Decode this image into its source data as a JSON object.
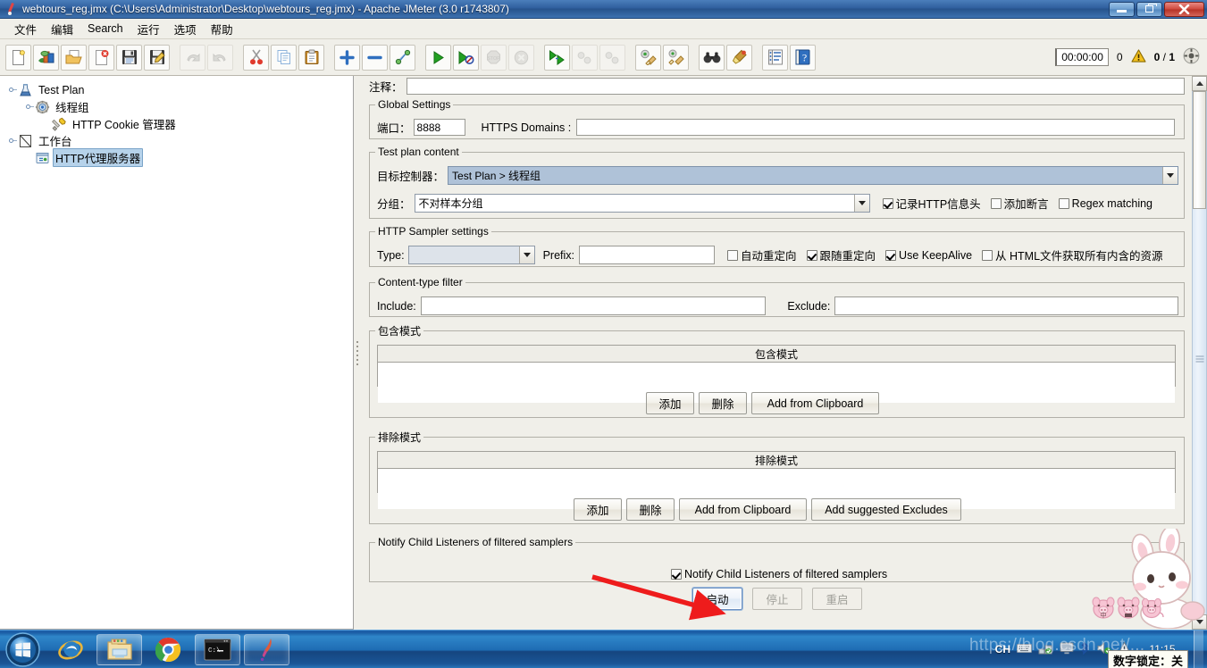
{
  "window": {
    "title": "webtours_reg.jmx (C:\\Users\\Administrator\\Desktop\\webtours_reg.jmx) - Apache JMeter (3.0 r1743807)",
    "app_icon": "jmeter-feather-icon",
    "minimize_label": "–",
    "maximize_label": "❐",
    "close_label": "✕"
  },
  "menubar": {
    "items": [
      {
        "label": "文件",
        "name": "menu-file"
      },
      {
        "label": "编辑",
        "name": "menu-edit"
      },
      {
        "label": "Search",
        "name": "menu-search"
      },
      {
        "label": "运行",
        "name": "menu-run"
      },
      {
        "label": "选项",
        "name": "menu-options"
      },
      {
        "label": "帮助",
        "name": "menu-help"
      }
    ]
  },
  "toolbar": {
    "buttons": [
      {
        "icon": "new-file-icon",
        "enabled": true
      },
      {
        "icon": "templates-icon",
        "enabled": true
      },
      {
        "icon": "open-folder-icon",
        "enabled": true
      },
      {
        "icon": "close-file-icon",
        "enabled": true
      },
      {
        "icon": "save-icon",
        "enabled": true
      },
      {
        "icon": "save-as-icon",
        "enabled": true
      },
      {
        "icon": "undo-icon",
        "enabled": false
      },
      {
        "icon": "redo-icon",
        "enabled": false
      },
      {
        "icon": "cut-icon",
        "enabled": true
      },
      {
        "icon": "copy-icon",
        "enabled": true
      },
      {
        "icon": "paste-icon",
        "enabled": true
      },
      {
        "icon": "expand-all-icon",
        "enabled": true
      },
      {
        "icon": "collapse-all-icon",
        "enabled": true
      },
      {
        "icon": "toggle-icon",
        "enabled": true
      },
      {
        "icon": "start-icon",
        "enabled": true
      },
      {
        "icon": "start-no-timers-icon",
        "enabled": true
      },
      {
        "icon": "stop-icon",
        "enabled": false
      },
      {
        "icon": "shutdown-icon",
        "enabled": false
      },
      {
        "icon": "start-remote-icon",
        "enabled": true
      },
      {
        "icon": "stop-remote-icon",
        "enabled": false
      },
      {
        "icon": "shutdown-remote-icon",
        "enabled": false
      },
      {
        "icon": "clear-icon",
        "enabled": true
      },
      {
        "icon": "clear-all-icon",
        "enabled": true
      },
      {
        "icon": "search-binoculars-icon",
        "enabled": true
      },
      {
        "icon": "reset-search-icon",
        "enabled": true
      },
      {
        "icon": "function-helper-icon",
        "enabled": true
      },
      {
        "icon": "help-icon",
        "enabled": true
      }
    ],
    "status": {
      "timer": "00:00:00",
      "warning_count": "0",
      "warning_icon": "warning-triangle-icon",
      "threads_active": "0",
      "threads_separator": "/",
      "threads_total": "1",
      "remote_icon": "remote-engines-icon"
    }
  },
  "tree": {
    "nodes": [
      {
        "label": "Test Plan",
        "icon": "test-plan-icon",
        "depth": 0,
        "selected": false,
        "expandable": true
      },
      {
        "label": "线程组",
        "icon": "thread-group-icon",
        "depth": 1,
        "selected": false,
        "expandable": true
      },
      {
        "label": "HTTP Cookie 管理器",
        "icon": "cookie-manager-icon",
        "depth": 2,
        "selected": false,
        "expandable": false
      },
      {
        "label": "工作台",
        "icon": "workbench-icon",
        "depth": 0,
        "selected": false,
        "expandable": true
      },
      {
        "label": "HTTP代理服务器",
        "icon": "http-proxy-server-icon",
        "depth": 1,
        "selected": true,
        "expandable": false
      }
    ]
  },
  "panel": {
    "comment_label": "注释：",
    "comment_value": "",
    "global_settings": {
      "legend": "Global Settings",
      "port_label": "端口：",
      "port_value": "8888",
      "https_domains_label": "HTTPS Domains :",
      "https_domains_value": ""
    },
    "test_plan_content": {
      "legend": "Test plan content",
      "target_controller_label": "目标控制器：",
      "target_controller_value": "Test Plan > 线程组",
      "grouping_label": "分组：",
      "grouping_value": "不对样本分组",
      "checkboxes": [
        {
          "label": "记录HTTP信息头",
          "checked": true,
          "name": "capture-http-headers-checkbox"
        },
        {
          "label": "添加断言",
          "checked": false,
          "name": "add-assertions-checkbox"
        },
        {
          "label": "Regex matching",
          "checked": false,
          "name": "regex-matching-checkbox"
        }
      ]
    },
    "http_sampler_settings": {
      "legend": "HTTP Sampler settings",
      "type_label": "Type:",
      "type_value": "",
      "prefix_label": "Prefix:",
      "prefix_value": "",
      "checkboxes": [
        {
          "label": "自动重定向",
          "checked": false,
          "name": "redirect-automatically-checkbox"
        },
        {
          "label": "跟随重定向",
          "checked": true,
          "name": "follow-redirects-checkbox"
        },
        {
          "label": "Use KeepAlive",
          "checked": true,
          "name": "use-keepalive-checkbox"
        },
        {
          "label": "从 HTML文件获取所有内含的资源",
          "checked": false,
          "name": "retrieve-embedded-resources-checkbox"
        }
      ]
    },
    "content_type_filter": {
      "legend": "Content-type filter",
      "include_label": "Include:",
      "include_value": "",
      "exclude_label": "Exclude:",
      "exclude_value": ""
    },
    "include_patterns": {
      "legend": "包含模式",
      "column_header": "包含模式",
      "rows": [],
      "buttons": [
        {
          "label": "添加",
          "name": "include-add-button",
          "enabled": true
        },
        {
          "label": "删除",
          "name": "include-delete-button",
          "enabled": true
        },
        {
          "label": "Add from Clipboard",
          "name": "include-add-from-clipboard-button",
          "enabled": true
        }
      ]
    },
    "exclude_patterns": {
      "legend": "排除模式",
      "column_header": "排除模式",
      "rows": [],
      "buttons": [
        {
          "label": "添加",
          "name": "exclude-add-button",
          "enabled": true
        },
        {
          "label": "删除",
          "name": "exclude-delete-button",
          "enabled": true
        },
        {
          "label": "Add from Clipboard",
          "name": "exclude-add-from-clipboard-button",
          "enabled": true
        },
        {
          "label": "Add suggested Excludes",
          "name": "add-suggested-excludes-button",
          "enabled": true
        }
      ]
    },
    "notify_section": {
      "legend": "Notify Child Listeners of filtered samplers",
      "checkbox_label": "Notify Child Listeners of filtered samplers",
      "checkbox_checked": true
    },
    "actions": [
      {
        "label": "启动",
        "name": "start-proxy-button",
        "enabled": true,
        "focused": true
      },
      {
        "label": "停止",
        "name": "stop-proxy-button",
        "enabled": false,
        "focused": false
      },
      {
        "label": "重启",
        "name": "restart-proxy-button",
        "enabled": false,
        "focused": false
      }
    ]
  },
  "annotation": {
    "type": "red-arrow",
    "color": "#ee1c1c",
    "points_to": "start-proxy-button"
  },
  "taskbar": {
    "start_icon": "windows-start-orb-icon",
    "items": [
      {
        "icon": "internet-explorer-icon",
        "name": "taskbar-internet-explorer",
        "framed": false
      },
      {
        "icon": "file-explorer-icon",
        "name": "taskbar-file-explorer",
        "framed": true
      },
      {
        "icon": "google-chrome-icon",
        "name": "taskbar-google-chrome",
        "framed": false
      },
      {
        "icon": "command-prompt-icon",
        "name": "taskbar-command-prompt",
        "framed": true
      },
      {
        "icon": "jmeter-feather-icon",
        "name": "taskbar-jmeter",
        "framed": true
      }
    ],
    "tray": {
      "ime_label": "CH",
      "icons": [
        "keyboard-icon",
        "network-icon",
        "display-icon",
        "bluetooth-icon",
        "volume-icon",
        "action-center-icon"
      ],
      "clock_time": "11:15",
      "num_lock_tooltip": "数字锁定：关"
    },
    "watermark": "https://blog.csdn.net/..."
  },
  "decoration": {
    "mascot": "white-bunny-mascot",
    "ime_pigs": [
      "pig-chinese-icon",
      "pig-punctuation-icon",
      "pig-toolbox-icon"
    ]
  },
  "colors": {
    "titlebar": "#2f5f9e",
    "accent_selection": "#b6d2ea",
    "panel_bg": "#f0efe9",
    "annotation_red": "#ee1c1c",
    "taskbar_blue": "#1e6cb4"
  }
}
